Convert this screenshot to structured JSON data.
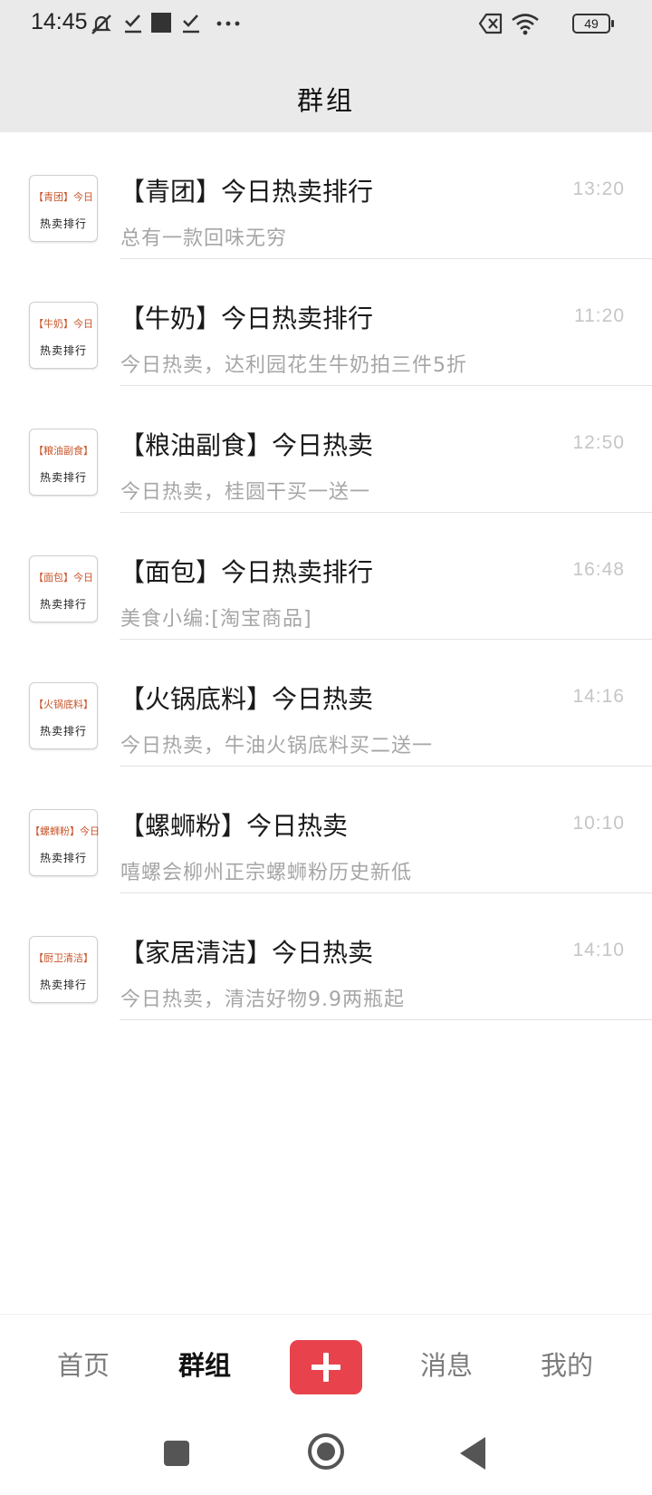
{
  "status_bar": {
    "time": "14:45",
    "battery": "49",
    "icons": [
      "mute-icon",
      "check-icon",
      "square-icon",
      "check-icon",
      "more-icon",
      "sim-x-icon",
      "wifi-icon",
      "battery-icon"
    ]
  },
  "header": {
    "title": "群组"
  },
  "groups": [
    {
      "thumb_tag": "【青团】今日",
      "thumb_sub": "热卖排行",
      "name": "【青团】今日热卖排行",
      "time": "13:20",
      "preview": "总有一款回味无穷"
    },
    {
      "thumb_tag": "【牛奶】今日",
      "thumb_sub": "热卖排行",
      "name": "【牛奶】今日热卖排行",
      "time": "11:20",
      "preview": "今日热卖，达利园花生牛奶拍三件5折"
    },
    {
      "thumb_tag": "【粮油副食】",
      "thumb_sub": "热卖排行",
      "name": "【粮油副食】今日热卖",
      "time": "12:50",
      "preview": "今日热卖，桂圆干买一送一"
    },
    {
      "thumb_tag": "【面包】今日",
      "thumb_sub": "热卖排行",
      "name": "【面包】今日热卖排行",
      "time": "16:48",
      "preview": "美食小编:[淘宝商品]"
    },
    {
      "thumb_tag": "【火锅底料】",
      "thumb_sub": "热卖排行",
      "name": "【火锅底料】今日热卖",
      "time": "14:16",
      "preview": "今日热卖，牛油火锅底料买二送一"
    },
    {
      "thumb_tag": "【螺蛳粉】今日",
      "thumb_sub": "热卖排行",
      "name": "【螺蛳粉】今日热卖",
      "time": "10:10",
      "preview": "嘻螺会柳州正宗螺蛳粉历史新低"
    },
    {
      "thumb_tag": "【厨卫清洁】",
      "thumb_sub": "热卖排行",
      "name": "【家居清洁】今日热卖",
      "time": "14:10",
      "preview": "今日热卖，清洁好物9.9两瓶起"
    }
  ],
  "tabbar": {
    "home": "首页",
    "groups": "群组",
    "add_icon": "plus-icon",
    "messages": "消息",
    "mine": "我的"
  },
  "colors": {
    "accent": "#e8434d",
    "thumb_tag": "#c8552a",
    "header_bg": "#eaeaea",
    "muted_text": "#a6a6a6"
  }
}
